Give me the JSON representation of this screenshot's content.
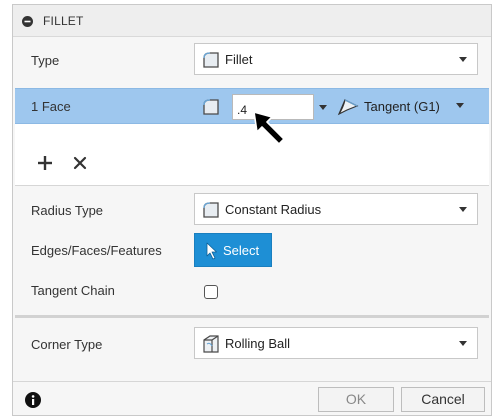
{
  "title": "FILLET",
  "type_row": {
    "label": "Type",
    "value": "Fillet"
  },
  "face_row": {
    "label": "1 Face",
    "radius_value": ".4",
    "continuity": "Tangent (G1)"
  },
  "list_controls": {
    "add": "+",
    "remove": "×"
  },
  "radius_type_row": {
    "label": "Radius Type",
    "value": "Constant Radius"
  },
  "edges_row": {
    "label": "Edges/Faces/Features",
    "button_label": "Select"
  },
  "tangent_chain_row": {
    "label": "Tangent Chain",
    "checked": false
  },
  "corner_type_row": {
    "label": "Corner Type",
    "value": "Rolling Ball"
  },
  "footer": {
    "ok_label": "OK",
    "cancel_label": "Cancel"
  },
  "colors": {
    "selected_row": "#9ec7ee",
    "select_button": "#1e8fd5",
    "background": "#f6f6f6"
  },
  "icons": [
    "collapse-icon",
    "fillet-icon",
    "tangent-icon",
    "cursor-arrow-icon",
    "plus-icon",
    "close-icon",
    "select-arrow-icon",
    "rolling-ball-icon",
    "info-icon",
    "chevron-down-icon"
  ]
}
